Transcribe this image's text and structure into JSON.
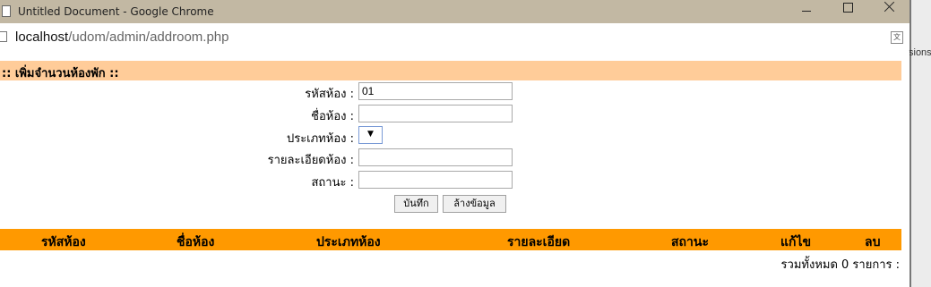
{
  "window": {
    "title": "Untitled Document - Google Chrome"
  },
  "address": {
    "host": "localhost",
    "path": "/udom/admin/addroom.php"
  },
  "side_tab": {
    "text": "sions"
  },
  "heading": {
    "text": ":: เพิ่มจำนวนห้องพัก ::"
  },
  "form": {
    "room_code_label": "รหัสห้อง :",
    "room_code_value": "01",
    "room_name_label": "ชื่อห้อง :",
    "room_type_label": "ประเภทห้อง :",
    "room_detail_label": "รายละเอียดห้อง :",
    "status_label": "สถานะ :",
    "save_label": "บันทึก",
    "clear_label": "ล้างข้อมูล"
  },
  "table": {
    "headers": [
      "รหัสห้อง",
      "ชื่อห้อง",
      "ประเภทห้อง",
      "รายละเอียด",
      "สถานะ",
      "แก้ไข",
      "ลบ"
    ]
  },
  "footer": {
    "total_text": "รวมทั้งหมด 0 รายการ :"
  },
  "colors": {
    "heading_bg": "#ffcc99",
    "table_header_bg": "#ff9900"
  }
}
